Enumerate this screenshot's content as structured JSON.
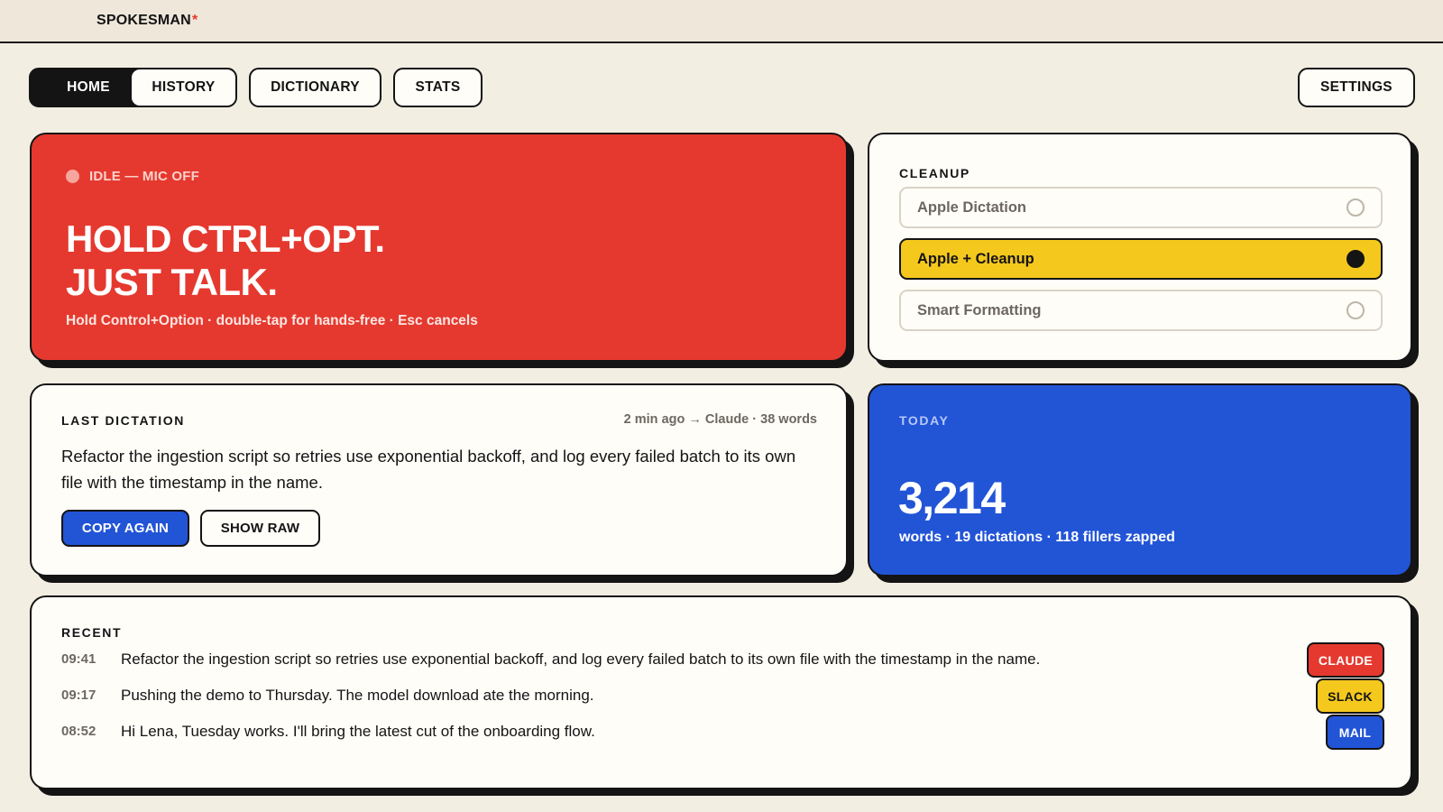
{
  "app": {
    "name": "SPOKESMAN",
    "mark": "*",
    "accent": "#e5392f"
  },
  "nav": {
    "tabs": [
      {
        "label": "HOME",
        "active": true
      },
      {
        "label": "HISTORY",
        "active": false
      },
      {
        "label": "DICTIONARY",
        "active": false
      },
      {
        "label": "STATS",
        "active": false
      }
    ],
    "settings_label": "SETTINGS"
  },
  "hero": {
    "status": "IDLE — MIC OFF",
    "headline_line1": "HOLD CTRL+OPT.",
    "headline_line2": "JUST TALK.",
    "hint": "Hold Control+Option · double-tap for hands-free · Esc cancels",
    "color": "#e5392f"
  },
  "cleanup": {
    "title": "CLEANUP",
    "options": [
      {
        "label": "Apple Dictation",
        "selected": false
      },
      {
        "label": "Apple + Cleanup",
        "selected": true
      },
      {
        "label": "Smart Formatting",
        "selected": false
      }
    ],
    "selected_color": "#f5c81d"
  },
  "last_dictation": {
    "title": "LAST DICTATION",
    "meta": "2 min ago → Claude · 38 words",
    "text": "Refactor the ingestion script so retries use exponential backoff, and log every failed batch to its own file with the timestamp in the name.",
    "copy_label": "COPY AGAIN",
    "raw_label": "SHOW RAW"
  },
  "today": {
    "title": "TODAY",
    "words": "3,214",
    "summary": "words · 19 dictations · 118 fillers zapped",
    "color": "#2254d6"
  },
  "recent": {
    "title": "RECENT",
    "items": [
      {
        "time": "09:41",
        "text": "Refactor the ingestion script so retries use exponential backoff, and log every failed batch to its own file with the timestamp in the name.",
        "app": "CLAUDE",
        "color": "#e5392f",
        "text_color": "#ffffff"
      },
      {
        "time": "09:17",
        "text": "Pushing the demo to Thursday. The model download ate the morning.",
        "app": "SLACK",
        "color": "#f5c81d",
        "text_color": "#141414"
      },
      {
        "time": "08:52",
        "text": "Hi Lena, Tuesday works. I'll bring the latest cut of the onboarding flow.",
        "app": "MAIL",
        "color": "#2254d6",
        "text_color": "#ffffff"
      }
    ]
  }
}
